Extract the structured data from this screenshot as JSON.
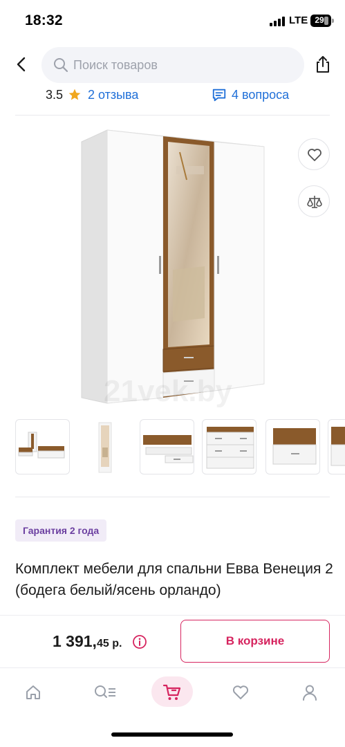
{
  "status_bar": {
    "time": "18:32",
    "network": "LTE",
    "battery": "29"
  },
  "header": {
    "search_placeholder": "Поиск товаров"
  },
  "rating": {
    "value": "3.5",
    "reviews_label": "2 отзыва",
    "questions_label": "4 вопроса"
  },
  "product": {
    "image_watermark": "21vek.by",
    "thumbnails_count_visible": 6,
    "warranty": "Гарантия 2 года",
    "title": "Комплект мебели для спальни Евва Венеция 2 (бодега белый/ясень орландо)"
  },
  "buy": {
    "price_main": "1 391,",
    "price_cents": "45",
    "price_currency": " р.",
    "cart_button": "В корзине"
  },
  "nav": {
    "items": [
      "home",
      "catalog",
      "cart",
      "favorites",
      "profile"
    ],
    "active": "cart"
  },
  "colors": {
    "accent": "#d6245f",
    "link": "#1f6fd8",
    "star": "#f0a71e",
    "warranty_bg": "#f1ecf7",
    "warranty_text": "#6b3fa0",
    "wood": "#8a5a2b"
  }
}
